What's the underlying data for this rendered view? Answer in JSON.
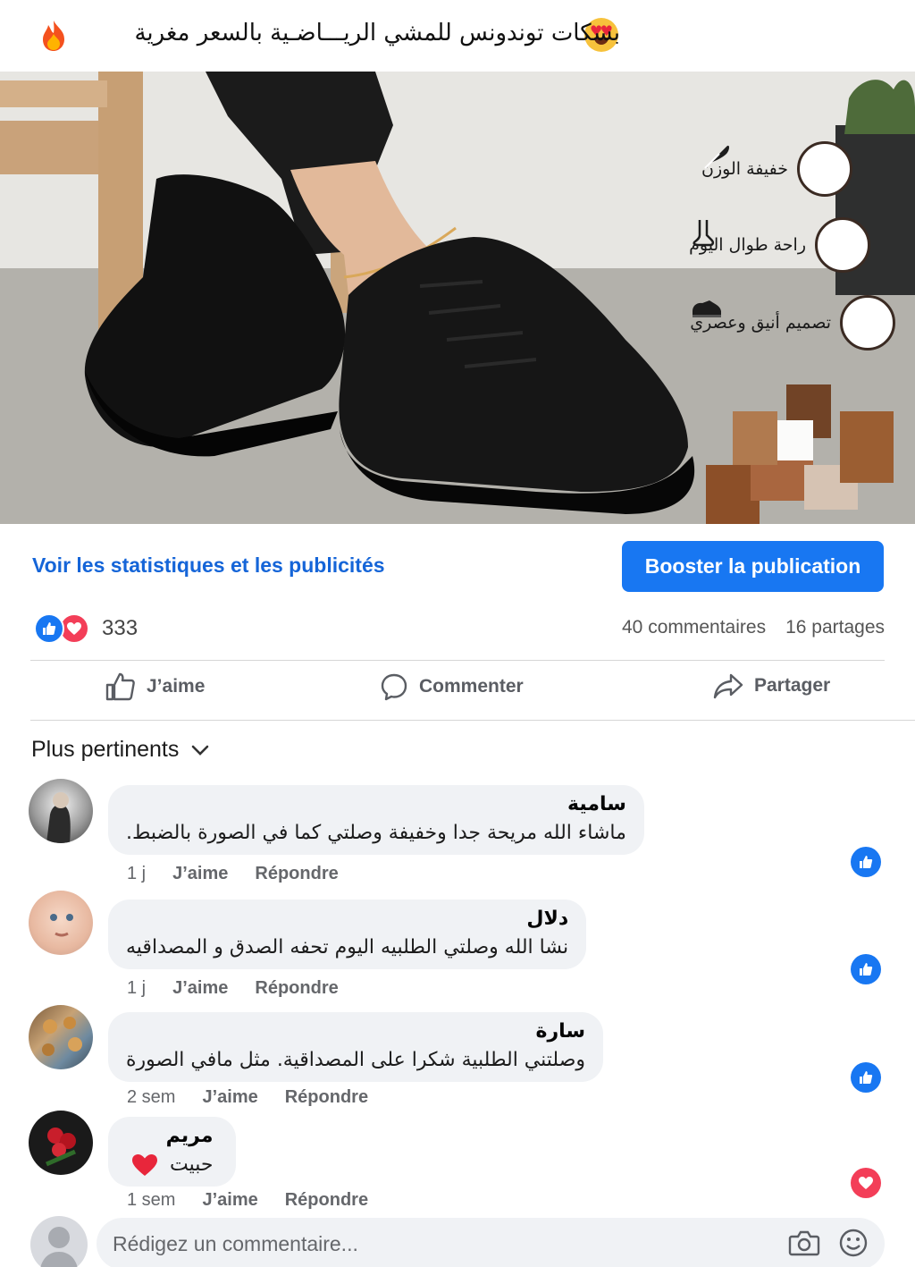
{
  "post": {
    "caption": "بسكات توندونس للمشي الريـــاضـية بالسعر مغرية",
    "emoji_start": "heart-eyes-emoji",
    "emoji_end": "fire-emoji"
  },
  "hero": {
    "features": [
      {
        "label": "خفيفة الوزن",
        "icon": "feather-icon"
      },
      {
        "label": "راحة طوال اليوم",
        "icon": "foot-icon"
      },
      {
        "label": "تصميم أنيق وعصري",
        "icon": "sneaker-icon"
      }
    ]
  },
  "actions_bar": {
    "stats_link": "Voir les statistiques et les publicités",
    "boost_button": "Booster la publication"
  },
  "engagement": {
    "reaction_count": "333",
    "comments": "40 commentaires",
    "shares": "16 partages"
  },
  "buttons": {
    "like": "J’aime",
    "comment": "Commenter",
    "share": "Partager"
  },
  "sort": {
    "label": "Plus pertinents"
  },
  "comments": [
    {
      "name": "سامية",
      "text": "ماشاء الله مريحة جدا وخفيفة وصلتي كما في الصورة بالضبط.",
      "time": "1 j",
      "like": "J’aime",
      "reply": "Répondre",
      "reaction": "like"
    },
    {
      "name": "دلال",
      "text": "نشا الله وصلتي الطلبيه اليوم تحفه الصدق  و المصداقيه",
      "time": "1 j",
      "like": "J’aime",
      "reply": "Répondre",
      "reaction": "like"
    },
    {
      "name": "سارة",
      "text": "وصلتني الطلبية شكرا على المصداقية. مثل مافي الصورة",
      "time": "2 sem",
      "like": "J’aime",
      "reply": "Répondre",
      "reaction": "like"
    },
    {
      "name": "مريم",
      "text": "حبيت",
      "time": "1 sem",
      "like": "J’aime",
      "reply": "Répondre",
      "reaction": "love"
    }
  ],
  "composer": {
    "placeholder": "Rédigez un commentaire..."
  },
  "colors": {
    "accent": "#1877f2",
    "link": "#1565d8",
    "love": "#f33e58",
    "bubble": "#f0f2f5"
  }
}
